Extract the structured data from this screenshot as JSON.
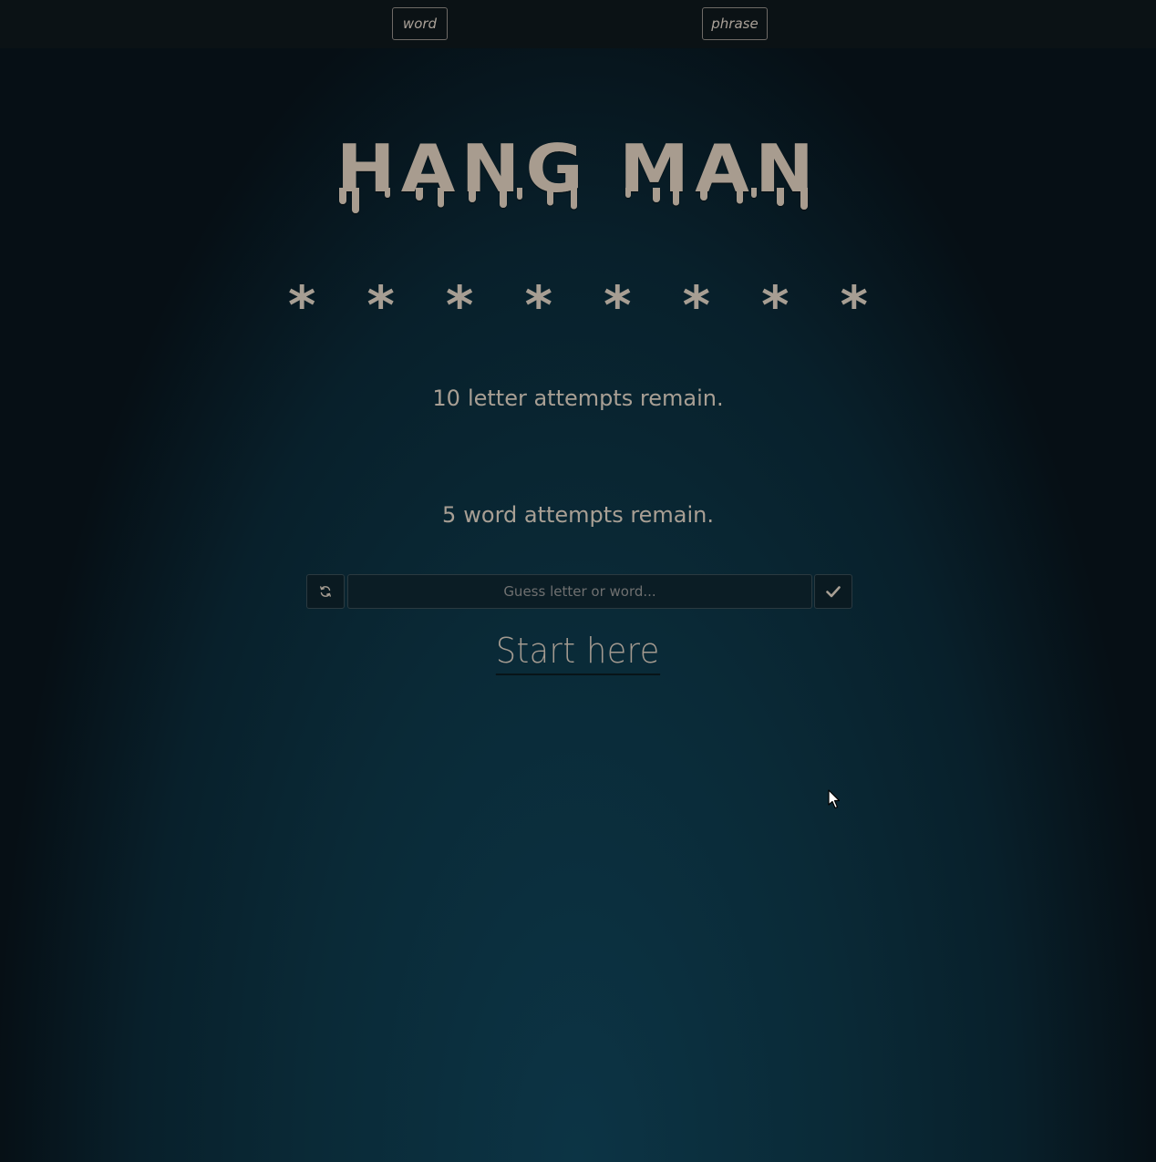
{
  "modes": {
    "word_label": "word",
    "phrase_label": "phrase"
  },
  "title": "HANG MAN",
  "masked_word": "* * * * * * * *",
  "letter_attempts": {
    "count": "10",
    "text": "letter attempts remain."
  },
  "word_attempts": {
    "count": "5",
    "text": "word attempts remain."
  },
  "guess": {
    "placeholder": "Guess letter or word...",
    "value": ""
  },
  "start_label": "Start here",
  "icons": {
    "reset": "refresh-icon",
    "submit": "checkmark-icon"
  },
  "colors": {
    "text": "#a89f94",
    "background_center": "#0c3445",
    "background_edge": "#060f15",
    "topbar": "#0b1215"
  }
}
